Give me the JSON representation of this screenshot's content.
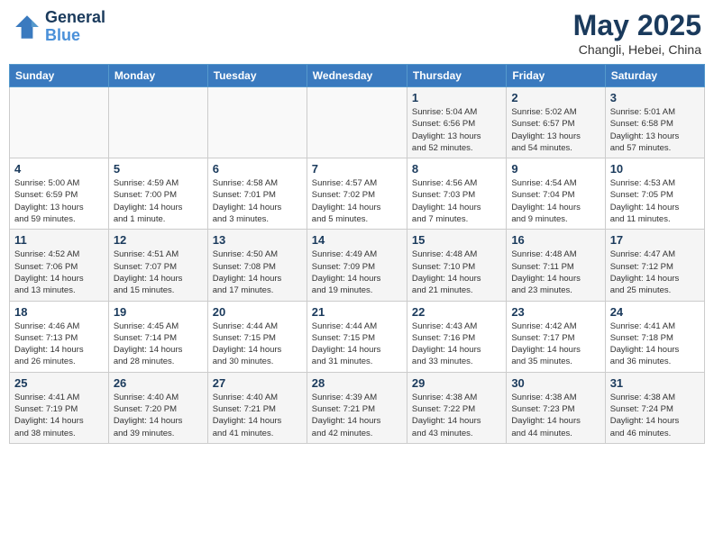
{
  "header": {
    "logo_line1": "General",
    "logo_line2": "Blue",
    "month": "May 2025",
    "location": "Changli, Hebei, China"
  },
  "weekdays": [
    "Sunday",
    "Monday",
    "Tuesday",
    "Wednesday",
    "Thursday",
    "Friday",
    "Saturday"
  ],
  "weeks": [
    [
      {
        "day": "",
        "info": ""
      },
      {
        "day": "",
        "info": ""
      },
      {
        "day": "",
        "info": ""
      },
      {
        "day": "",
        "info": ""
      },
      {
        "day": "1",
        "info": "Sunrise: 5:04 AM\nSunset: 6:56 PM\nDaylight: 13 hours\nand 52 minutes."
      },
      {
        "day": "2",
        "info": "Sunrise: 5:02 AM\nSunset: 6:57 PM\nDaylight: 13 hours\nand 54 minutes."
      },
      {
        "day": "3",
        "info": "Sunrise: 5:01 AM\nSunset: 6:58 PM\nDaylight: 13 hours\nand 57 minutes."
      }
    ],
    [
      {
        "day": "4",
        "info": "Sunrise: 5:00 AM\nSunset: 6:59 PM\nDaylight: 13 hours\nand 59 minutes."
      },
      {
        "day": "5",
        "info": "Sunrise: 4:59 AM\nSunset: 7:00 PM\nDaylight: 14 hours\nand 1 minute."
      },
      {
        "day": "6",
        "info": "Sunrise: 4:58 AM\nSunset: 7:01 PM\nDaylight: 14 hours\nand 3 minutes."
      },
      {
        "day": "7",
        "info": "Sunrise: 4:57 AM\nSunset: 7:02 PM\nDaylight: 14 hours\nand 5 minutes."
      },
      {
        "day": "8",
        "info": "Sunrise: 4:56 AM\nSunset: 7:03 PM\nDaylight: 14 hours\nand 7 minutes."
      },
      {
        "day": "9",
        "info": "Sunrise: 4:54 AM\nSunset: 7:04 PM\nDaylight: 14 hours\nand 9 minutes."
      },
      {
        "day": "10",
        "info": "Sunrise: 4:53 AM\nSunset: 7:05 PM\nDaylight: 14 hours\nand 11 minutes."
      }
    ],
    [
      {
        "day": "11",
        "info": "Sunrise: 4:52 AM\nSunset: 7:06 PM\nDaylight: 14 hours\nand 13 minutes."
      },
      {
        "day": "12",
        "info": "Sunrise: 4:51 AM\nSunset: 7:07 PM\nDaylight: 14 hours\nand 15 minutes."
      },
      {
        "day": "13",
        "info": "Sunrise: 4:50 AM\nSunset: 7:08 PM\nDaylight: 14 hours\nand 17 minutes."
      },
      {
        "day": "14",
        "info": "Sunrise: 4:49 AM\nSunset: 7:09 PM\nDaylight: 14 hours\nand 19 minutes."
      },
      {
        "day": "15",
        "info": "Sunrise: 4:48 AM\nSunset: 7:10 PM\nDaylight: 14 hours\nand 21 minutes."
      },
      {
        "day": "16",
        "info": "Sunrise: 4:48 AM\nSunset: 7:11 PM\nDaylight: 14 hours\nand 23 minutes."
      },
      {
        "day": "17",
        "info": "Sunrise: 4:47 AM\nSunset: 7:12 PM\nDaylight: 14 hours\nand 25 minutes."
      }
    ],
    [
      {
        "day": "18",
        "info": "Sunrise: 4:46 AM\nSunset: 7:13 PM\nDaylight: 14 hours\nand 26 minutes."
      },
      {
        "day": "19",
        "info": "Sunrise: 4:45 AM\nSunset: 7:14 PM\nDaylight: 14 hours\nand 28 minutes."
      },
      {
        "day": "20",
        "info": "Sunrise: 4:44 AM\nSunset: 7:15 PM\nDaylight: 14 hours\nand 30 minutes."
      },
      {
        "day": "21",
        "info": "Sunrise: 4:44 AM\nSunset: 7:15 PM\nDaylight: 14 hours\nand 31 minutes."
      },
      {
        "day": "22",
        "info": "Sunrise: 4:43 AM\nSunset: 7:16 PM\nDaylight: 14 hours\nand 33 minutes."
      },
      {
        "day": "23",
        "info": "Sunrise: 4:42 AM\nSunset: 7:17 PM\nDaylight: 14 hours\nand 35 minutes."
      },
      {
        "day": "24",
        "info": "Sunrise: 4:41 AM\nSunset: 7:18 PM\nDaylight: 14 hours\nand 36 minutes."
      }
    ],
    [
      {
        "day": "25",
        "info": "Sunrise: 4:41 AM\nSunset: 7:19 PM\nDaylight: 14 hours\nand 38 minutes."
      },
      {
        "day": "26",
        "info": "Sunrise: 4:40 AM\nSunset: 7:20 PM\nDaylight: 14 hours\nand 39 minutes."
      },
      {
        "day": "27",
        "info": "Sunrise: 4:40 AM\nSunset: 7:21 PM\nDaylight: 14 hours\nand 41 minutes."
      },
      {
        "day": "28",
        "info": "Sunrise: 4:39 AM\nSunset: 7:21 PM\nDaylight: 14 hours\nand 42 minutes."
      },
      {
        "day": "29",
        "info": "Sunrise: 4:38 AM\nSunset: 7:22 PM\nDaylight: 14 hours\nand 43 minutes."
      },
      {
        "day": "30",
        "info": "Sunrise: 4:38 AM\nSunset: 7:23 PM\nDaylight: 14 hours\nand 44 minutes."
      },
      {
        "day": "31",
        "info": "Sunrise: 4:38 AM\nSunset: 7:24 PM\nDaylight: 14 hours\nand 46 minutes."
      }
    ]
  ]
}
